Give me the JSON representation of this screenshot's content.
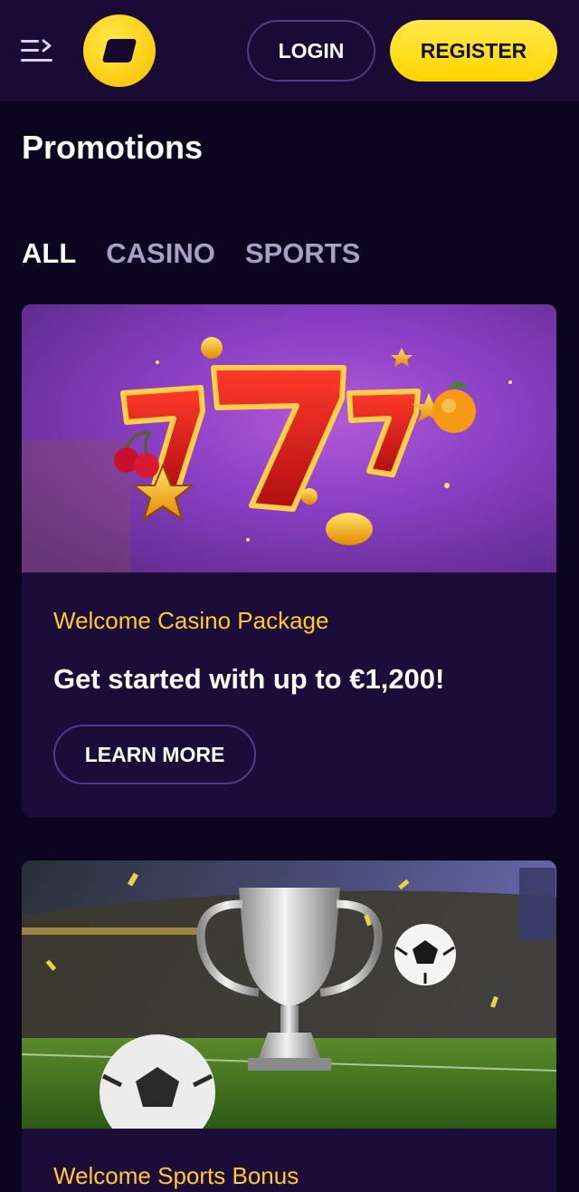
{
  "header": {
    "menu_icon": "menu-collapse-icon",
    "logo_icon": "brand-logo",
    "login_label": "LOGIN",
    "register_label": "REGISTER"
  },
  "page": {
    "title": "Promotions"
  },
  "tabs": [
    {
      "label": "ALL",
      "active": true
    },
    {
      "label": "CASINO",
      "active": false
    },
    {
      "label": "SPORTS",
      "active": false
    }
  ],
  "promotions": [
    {
      "eyebrow": "Welcome Casino Package",
      "headline": "Get started with up to €1,200!",
      "button_label": "LEARN MORE",
      "image": "slot-777-illustration"
    },
    {
      "eyebrow": "Welcome Sports Bonus",
      "image": "trophy-stadium-illustration"
    }
  ],
  "colors": {
    "background": "#0c0520",
    "header": "#1a0b36",
    "card": "#1c0c3a",
    "accent_yellow": "#ffd500",
    "eyebrow_yellow": "#ffcb2b",
    "tab_inactive": "#a79fc4",
    "outline": "#4f3a8a"
  }
}
